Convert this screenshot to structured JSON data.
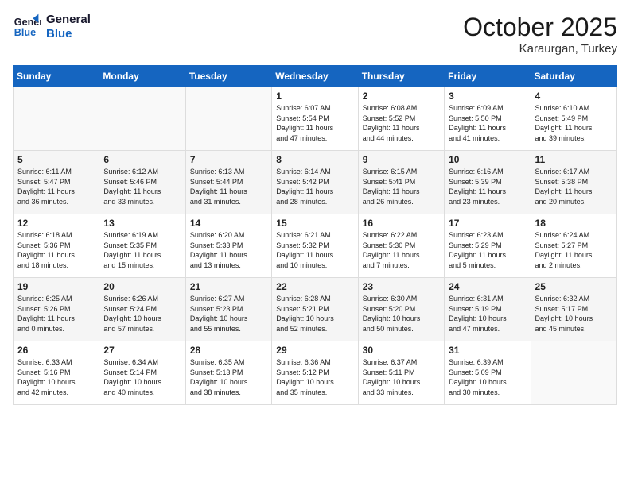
{
  "header": {
    "logo_line1": "General",
    "logo_line2": "Blue",
    "month": "October 2025",
    "location": "Karaurgan, Turkey"
  },
  "weekdays": [
    "Sunday",
    "Monday",
    "Tuesday",
    "Wednesday",
    "Thursday",
    "Friday",
    "Saturday"
  ],
  "weeks": [
    [
      {
        "day": "",
        "info": ""
      },
      {
        "day": "",
        "info": ""
      },
      {
        "day": "",
        "info": ""
      },
      {
        "day": "1",
        "info": "Sunrise: 6:07 AM\nSunset: 5:54 PM\nDaylight: 11 hours\nand 47 minutes."
      },
      {
        "day": "2",
        "info": "Sunrise: 6:08 AM\nSunset: 5:52 PM\nDaylight: 11 hours\nand 44 minutes."
      },
      {
        "day": "3",
        "info": "Sunrise: 6:09 AM\nSunset: 5:50 PM\nDaylight: 11 hours\nand 41 minutes."
      },
      {
        "day": "4",
        "info": "Sunrise: 6:10 AM\nSunset: 5:49 PM\nDaylight: 11 hours\nand 39 minutes."
      }
    ],
    [
      {
        "day": "5",
        "info": "Sunrise: 6:11 AM\nSunset: 5:47 PM\nDaylight: 11 hours\nand 36 minutes."
      },
      {
        "day": "6",
        "info": "Sunrise: 6:12 AM\nSunset: 5:46 PM\nDaylight: 11 hours\nand 33 minutes."
      },
      {
        "day": "7",
        "info": "Sunrise: 6:13 AM\nSunset: 5:44 PM\nDaylight: 11 hours\nand 31 minutes."
      },
      {
        "day": "8",
        "info": "Sunrise: 6:14 AM\nSunset: 5:42 PM\nDaylight: 11 hours\nand 28 minutes."
      },
      {
        "day": "9",
        "info": "Sunrise: 6:15 AM\nSunset: 5:41 PM\nDaylight: 11 hours\nand 26 minutes."
      },
      {
        "day": "10",
        "info": "Sunrise: 6:16 AM\nSunset: 5:39 PM\nDaylight: 11 hours\nand 23 minutes."
      },
      {
        "day": "11",
        "info": "Sunrise: 6:17 AM\nSunset: 5:38 PM\nDaylight: 11 hours\nand 20 minutes."
      }
    ],
    [
      {
        "day": "12",
        "info": "Sunrise: 6:18 AM\nSunset: 5:36 PM\nDaylight: 11 hours\nand 18 minutes."
      },
      {
        "day": "13",
        "info": "Sunrise: 6:19 AM\nSunset: 5:35 PM\nDaylight: 11 hours\nand 15 minutes."
      },
      {
        "day": "14",
        "info": "Sunrise: 6:20 AM\nSunset: 5:33 PM\nDaylight: 11 hours\nand 13 minutes."
      },
      {
        "day": "15",
        "info": "Sunrise: 6:21 AM\nSunset: 5:32 PM\nDaylight: 11 hours\nand 10 minutes."
      },
      {
        "day": "16",
        "info": "Sunrise: 6:22 AM\nSunset: 5:30 PM\nDaylight: 11 hours\nand 7 minutes."
      },
      {
        "day": "17",
        "info": "Sunrise: 6:23 AM\nSunset: 5:29 PM\nDaylight: 11 hours\nand 5 minutes."
      },
      {
        "day": "18",
        "info": "Sunrise: 6:24 AM\nSunset: 5:27 PM\nDaylight: 11 hours\nand 2 minutes."
      }
    ],
    [
      {
        "day": "19",
        "info": "Sunrise: 6:25 AM\nSunset: 5:26 PM\nDaylight: 11 hours\nand 0 minutes."
      },
      {
        "day": "20",
        "info": "Sunrise: 6:26 AM\nSunset: 5:24 PM\nDaylight: 10 hours\nand 57 minutes."
      },
      {
        "day": "21",
        "info": "Sunrise: 6:27 AM\nSunset: 5:23 PM\nDaylight: 10 hours\nand 55 minutes."
      },
      {
        "day": "22",
        "info": "Sunrise: 6:28 AM\nSunset: 5:21 PM\nDaylight: 10 hours\nand 52 minutes."
      },
      {
        "day": "23",
        "info": "Sunrise: 6:30 AM\nSunset: 5:20 PM\nDaylight: 10 hours\nand 50 minutes."
      },
      {
        "day": "24",
        "info": "Sunrise: 6:31 AM\nSunset: 5:19 PM\nDaylight: 10 hours\nand 47 minutes."
      },
      {
        "day": "25",
        "info": "Sunrise: 6:32 AM\nSunset: 5:17 PM\nDaylight: 10 hours\nand 45 minutes."
      }
    ],
    [
      {
        "day": "26",
        "info": "Sunrise: 6:33 AM\nSunset: 5:16 PM\nDaylight: 10 hours\nand 42 minutes."
      },
      {
        "day": "27",
        "info": "Sunrise: 6:34 AM\nSunset: 5:14 PM\nDaylight: 10 hours\nand 40 minutes."
      },
      {
        "day": "28",
        "info": "Sunrise: 6:35 AM\nSunset: 5:13 PM\nDaylight: 10 hours\nand 38 minutes."
      },
      {
        "day": "29",
        "info": "Sunrise: 6:36 AM\nSunset: 5:12 PM\nDaylight: 10 hours\nand 35 minutes."
      },
      {
        "day": "30",
        "info": "Sunrise: 6:37 AM\nSunset: 5:11 PM\nDaylight: 10 hours\nand 33 minutes."
      },
      {
        "day": "31",
        "info": "Sunrise: 6:39 AM\nSunset: 5:09 PM\nDaylight: 10 hours\nand 30 minutes."
      },
      {
        "day": "",
        "info": ""
      }
    ]
  ]
}
